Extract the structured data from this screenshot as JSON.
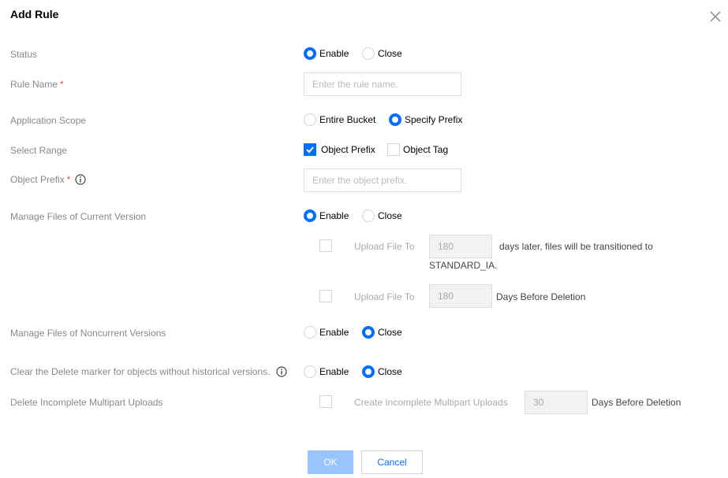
{
  "dialog": {
    "title": "Add Rule"
  },
  "status": {
    "label": "Status",
    "options": [
      "Enable",
      "Close"
    ]
  },
  "rule_name": {
    "label": "Rule Name",
    "required_mark": "*",
    "placeholder": "Enter the rule name."
  },
  "scope": {
    "label": "Application Scope",
    "options": [
      "Entire Bucket",
      "Specify Prefix"
    ]
  },
  "range": {
    "label": "Select Range",
    "options": [
      "Object Prefix",
      "Object Tag"
    ]
  },
  "object_prefix": {
    "label": "Object Prefix",
    "required_mark": "*",
    "placeholder": "Enter the object prefix."
  },
  "current_version": {
    "label": "Manage Files of Current Version",
    "options": [
      "Enable",
      "Close"
    ],
    "transition": {
      "label": "Upload File To",
      "days": "180",
      "suffix_line1": "days later, files will be transitioned to",
      "suffix_line2": "STANDARD_IA."
    },
    "deletion": {
      "label": "Upload File To",
      "days": "180",
      "suffix": "Days Before Deletion"
    }
  },
  "noncurrent": {
    "label": "Manage Files of Noncurrent Versions",
    "options": [
      "Enable",
      "Close"
    ]
  },
  "delete_marker": {
    "label": "Clear the Delete marker for objects without historical versions.",
    "options": [
      "Enable",
      "Close"
    ]
  },
  "multipart": {
    "label": "Delete Incomplete Multipart Uploads",
    "option_label": "Create Incomplete Multipart Uploads",
    "days": "30",
    "suffix": "Days Before Deletion"
  },
  "footer": {
    "ok": "OK",
    "cancel": "Cancel"
  },
  "colors": {
    "accent": "#006eff",
    "required": "#e54545",
    "ok_disabled": "#99c5ff"
  }
}
